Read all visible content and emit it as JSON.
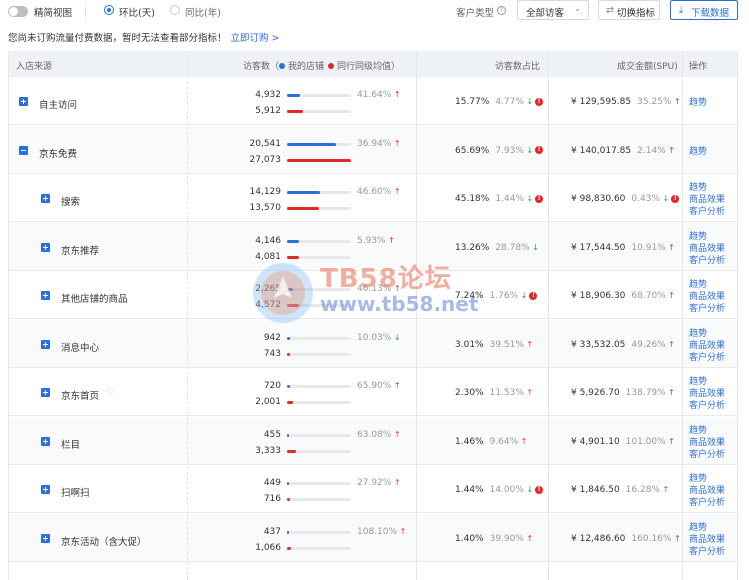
{
  "toolbar": {
    "simple_view": "精简视图",
    "mom_label": "环比(天)",
    "yoy_label": "同比(年)",
    "customer_type_label": "客户类型",
    "customer_select": "全部访客",
    "switch_metrics": "切换指标",
    "download": "下载数据"
  },
  "notice": {
    "text": "您尚未订购流量付费数据，暂时无法查看部分指标！",
    "link": "立即订购 >"
  },
  "table": {
    "headers": {
      "source": "入店来源",
      "visitors": "访客数（",
      "my_store": "我的店铺",
      "peer": "同行同级均值）",
      "share": "访客数占比",
      "amount": "成交金额(SPU)",
      "ops": "操作"
    },
    "colors": {
      "mine": "#2b6fde",
      "peer": "#e02a2a"
    },
    "rows": [
      {
        "name": "自主访问",
        "mine": "4,932",
        "peer": "5,912",
        "mine_frac": 0.21,
        "peer_frac": 0.25,
        "pct": "41.64%",
        "pct_dir": "up",
        "share": "15.77%",
        "share_chg": "4.77%",
        "share_dir": "down",
        "share_warn": true,
        "amount": "¥ 129,595.85",
        "amt_chg": "35.25%",
        "amt_dir": "up",
        "amt_warn": false,
        "ops": [
          "趋势"
        ],
        "level": 0,
        "expanded": false
      },
      {
        "name": "京东免费",
        "mine": "20,541",
        "peer": "27,073",
        "mine_frac": 0.76,
        "peer_frac": 1.0,
        "pct": "36.94%",
        "pct_dir": "up",
        "share": "65.69%",
        "share_chg": "7.93%",
        "share_dir": "down",
        "share_warn": true,
        "amount": "¥ 140,017.85",
        "amt_chg": "2.14%",
        "amt_dir": "up",
        "amt_warn": false,
        "ops": [
          "趋势"
        ],
        "level": 0,
        "expanded": true
      },
      {
        "name": "搜索",
        "mine": "14,129",
        "peer": "13,570",
        "mine_frac": 0.52,
        "peer_frac": 0.5,
        "pct": "46.60%",
        "pct_dir": "up",
        "share": "45.18%",
        "share_chg": "1.44%",
        "share_dir": "down",
        "share_warn": true,
        "amount": "¥ 98,830.60",
        "amt_chg": "0.43%",
        "amt_dir": "down",
        "amt_warn": true,
        "ops": [
          "趋势",
          "商品效果",
          "客户分析"
        ],
        "level": 1
      },
      {
        "name": "京东推荐",
        "mine": "4,146",
        "peer": "4,081",
        "mine_frac": 0.18,
        "peer_frac": 0.18,
        "pct": "5.93%",
        "pct_dir": "up",
        "share": "13.26%",
        "share_chg": "28.78%",
        "share_dir": "down",
        "share_warn": false,
        "amount": "¥ 17,544.50",
        "amt_chg": "10.91%",
        "amt_dir": "up",
        "amt_warn": false,
        "ops": [
          "趋势",
          "商品效果",
          "客户分析"
        ],
        "level": 1
      },
      {
        "name": "其他店铺的商品",
        "mine": "2,265",
        "peer": "4,572",
        "mine_frac": 0.1,
        "peer_frac": 0.18,
        "pct": "46.13%",
        "pct_dir": "up",
        "share": "7.24%",
        "share_chg": "1.76%",
        "share_dir": "down",
        "share_warn": true,
        "amount": "¥ 18,906.30",
        "amt_chg": "68.70%",
        "amt_dir": "up",
        "amt_warn": false,
        "ops": [
          "趋势",
          "商品效果",
          "客户分析"
        ],
        "level": 1
      },
      {
        "name": "消息中心",
        "mine": "942",
        "peer": "743",
        "mine_frac": 0.05,
        "peer_frac": 0.04,
        "pct": "10.03%",
        "pct_dir": "down",
        "share": "3.01%",
        "share_chg": "39.51%",
        "share_dir": "up",
        "share_warn": false,
        "amount": "¥ 33,532.05",
        "amt_chg": "49.26%",
        "amt_dir": "up",
        "amt_warn": false,
        "ops": [
          "趋势",
          "商品效果",
          "客户分析"
        ],
        "level": 1
      },
      {
        "name": "京东首页",
        "mine": "720",
        "peer": "2,001",
        "mine_frac": 0.04,
        "peer_frac": 0.09,
        "pct": "65.90%",
        "pct_dir": "up",
        "share": "2.30%",
        "share_chg": "11.53%",
        "share_dir": "up",
        "share_warn": false,
        "amount": "¥ 5,926.70",
        "amt_chg": "138.79%",
        "amt_dir": "up",
        "amt_warn": false,
        "ops": [
          "趋势",
          "商品效果",
          "客户分析"
        ],
        "level": 1,
        "heart": true
      },
      {
        "name": "栏目",
        "mine": "455",
        "peer": "3,333",
        "mine_frac": 0.03,
        "peer_frac": 0.14,
        "pct": "63.08%",
        "pct_dir": "up",
        "share": "1.46%",
        "share_chg": "9.64%",
        "share_dir": "up",
        "share_warn": false,
        "amount": "¥ 4,901.10",
        "amt_chg": "101.00%",
        "amt_dir": "up",
        "amt_warn": false,
        "ops": [
          "趋势",
          "商品效果",
          "客户分析"
        ],
        "level": 1
      },
      {
        "name": "扫啊扫",
        "mine": "449",
        "peer": "716",
        "mine_frac": 0.03,
        "peer_frac": 0.04,
        "pct": "27.92%",
        "pct_dir": "up",
        "share": "1.44%",
        "share_chg": "14.00%",
        "share_dir": "down",
        "share_warn": true,
        "amount": "¥ 1,846.50",
        "amt_chg": "16.28%",
        "amt_dir": "up",
        "amt_warn": false,
        "ops": [
          "趋势",
          "商品效果",
          "客户分析"
        ],
        "level": 1
      },
      {
        "name": "京东活动（含大促）",
        "mine": "437",
        "peer": "1,066",
        "mine_frac": 0.03,
        "peer_frac": 0.06,
        "pct": "108.10%",
        "pct_dir": "up",
        "share": "1.40%",
        "share_chg": "39.90%",
        "share_dir": "up",
        "share_warn": false,
        "amount": "¥ 12,486.60",
        "amt_chg": "160.16%",
        "amt_dir": "up",
        "amt_warn": false,
        "ops": [
          "趋势",
          "商品效果",
          "客户分析"
        ],
        "level": 1
      }
    ]
  },
  "watermark": {
    "line1": "TB58论坛",
    "line2": "www.tb58.net"
  },
  "icons": {
    "help": "help-circle-icon",
    "switch": "switch-icon",
    "download": "download-icon",
    "heart": "heart-icon",
    "arrow_up": "arrow-up-icon",
    "arrow_down": "arrow-down-icon",
    "warn": "warning-icon"
  }
}
